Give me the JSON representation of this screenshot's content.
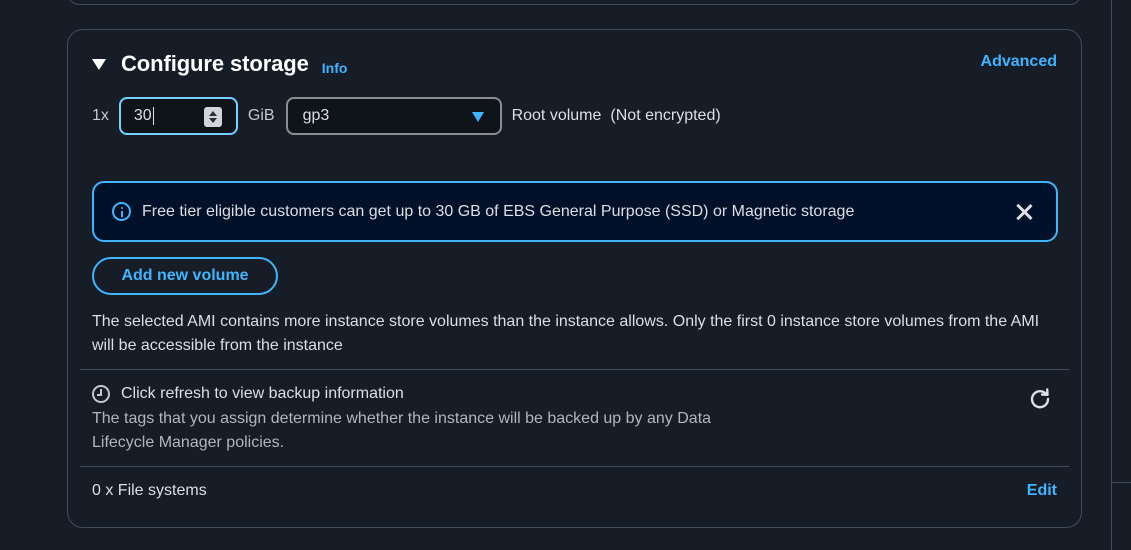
{
  "section": {
    "title": "Configure storage",
    "info_label": "Info",
    "advanced_label": "Advanced"
  },
  "volume": {
    "multiplier": "1x",
    "size_value": "30",
    "unit": "GiB",
    "type_value": "gp3",
    "root_label": "Root volume",
    "encryption_label": "(Not encrypted)"
  },
  "alert": {
    "text": "Free tier eligible customers can get up to 30 GB of EBS General Purpose (SSD) or Magnetic storage"
  },
  "add_volume_label": "Add new volume",
  "warning_text": "The selected AMI contains more instance store volumes than the instance allows. Only the first 0 instance store volumes from the AMI will be accessible from the instance",
  "backup": {
    "title": "Click refresh to view backup information",
    "description": "The tags that you assign determine whether the instance will be backed up by any Data Lifecycle Manager policies."
  },
  "file_systems": {
    "label": "0 x File systems",
    "edit_label": "Edit"
  },
  "colors": {
    "background": "#161d26",
    "accent": "#42b4ff",
    "border": "#414d5c",
    "alert_bg": "#001129",
    "focus_border": "#75cfff"
  },
  "icons": [
    "caret-down-icon",
    "stepper-icon",
    "select-caret-icon",
    "info-circle-icon",
    "close-icon",
    "clock-icon",
    "refresh-icon"
  ]
}
